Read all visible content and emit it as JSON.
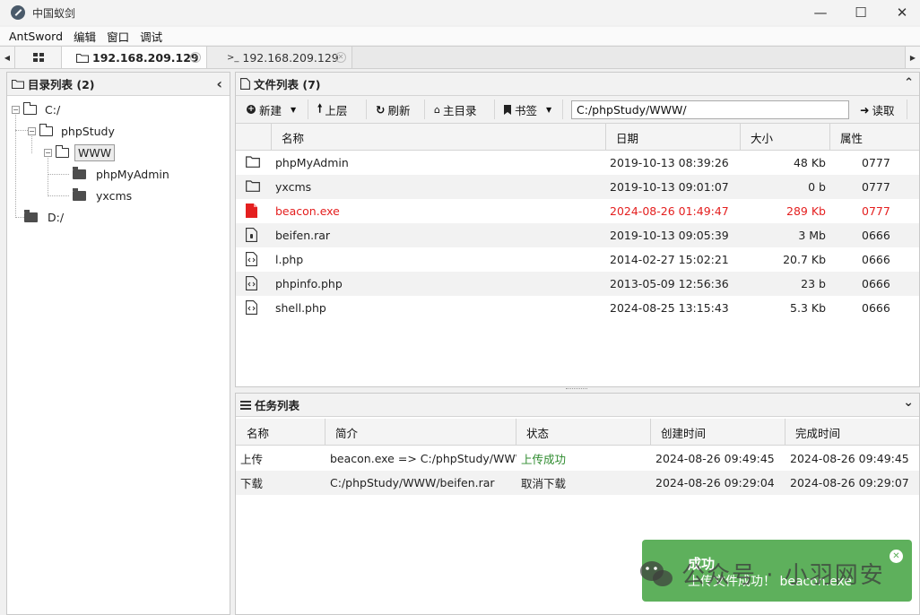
{
  "window": {
    "title": "中国蚁剑",
    "minimize": "—",
    "maximize": "☐",
    "close": "✕"
  },
  "menu": [
    "AntSword",
    "编辑",
    "窗口",
    "调试"
  ],
  "tabs": {
    "left_arrow": "◀",
    "right_arrow": "▶",
    "home_icon": "grid-icon",
    "items": [
      {
        "label": "192.168.209.129",
        "icon": "folder-icon",
        "active": true,
        "close": "✕"
      },
      {
        "label": "192.168.209.129",
        "icon": "terminal-icon",
        "prefix": ">_",
        "active": false,
        "close": "✕"
      }
    ]
  },
  "dir_panel": {
    "title": "目录列表 (2)",
    "collapse": "‹",
    "tree": {
      "c_drive": "C:/",
      "phpstudy": "phpStudy",
      "www": "WWW",
      "phpmyadmin": "phpMyAdmin",
      "yxcms": "yxcms",
      "d_drive": "D:/"
    }
  },
  "file_panel": {
    "title": "文件列表 (7)",
    "collapse": "⌃",
    "toolbar": {
      "new": "新建",
      "up": "上层",
      "refresh": "刷新",
      "home": "主目录",
      "bookmark": "书签",
      "path": "C:/phpStudy/WWW/",
      "read": "读取"
    },
    "columns": [
      "名称",
      "日期",
      "大小",
      "属性"
    ],
    "rows": [
      {
        "name": "phpMyAdmin",
        "date": "2019-10-13 08:39:26",
        "size": "48 Kb",
        "attr": "0777",
        "type": "folder"
      },
      {
        "name": "yxcms",
        "date": "2019-10-13 09:01:07",
        "size": "0 b",
        "attr": "0777",
        "type": "folder"
      },
      {
        "name": "beacon.exe",
        "date": "2024-08-26 01:49:47",
        "size": "289 Kb",
        "attr": "0777",
        "type": "exe",
        "highlight": "#e41f1f"
      },
      {
        "name": "beifen.rar",
        "date": "2019-10-13 09:05:39",
        "size": "3 Mb",
        "attr": "0666",
        "type": "archive"
      },
      {
        "name": "l.php",
        "date": "2014-02-27 15:02:21",
        "size": "20.7 Kb",
        "attr": "0666",
        "type": "code"
      },
      {
        "name": "phpinfo.php",
        "date": "2013-05-09 12:56:36",
        "size": "23 b",
        "attr": "0666",
        "type": "code"
      },
      {
        "name": "shell.php",
        "date": "2024-08-25 13:15:43",
        "size": "5.3 Kb",
        "attr": "0666",
        "type": "code"
      }
    ]
  },
  "task_panel": {
    "title": "任务列表",
    "collapse": "⌄",
    "columns": [
      "名称",
      "简介",
      "状态",
      "创建时间",
      "完成时间"
    ],
    "rows": [
      {
        "name": "上传",
        "desc": "beacon.exe => C:/phpStudy/WWW/",
        "status": "上传成功",
        "status_color": "#2e8b2e",
        "created": "2024-08-26 09:49:45",
        "finished": "2024-08-26 09:49:45"
      },
      {
        "name": "下载",
        "desc": "C:/phpStudy/WWW/beifen.rar",
        "status": "取消下载",
        "status_color": "#222222",
        "created": "2024-08-26 09:29:04",
        "finished": "2024-08-26 09:29:07"
      }
    ]
  },
  "toast": {
    "title": "成功",
    "message": "上传文件成功！ beacon.exe",
    "close": "✕",
    "color": "#5eb05c"
  },
  "watermark": {
    "text": "公众号 · 小羽网安"
  }
}
